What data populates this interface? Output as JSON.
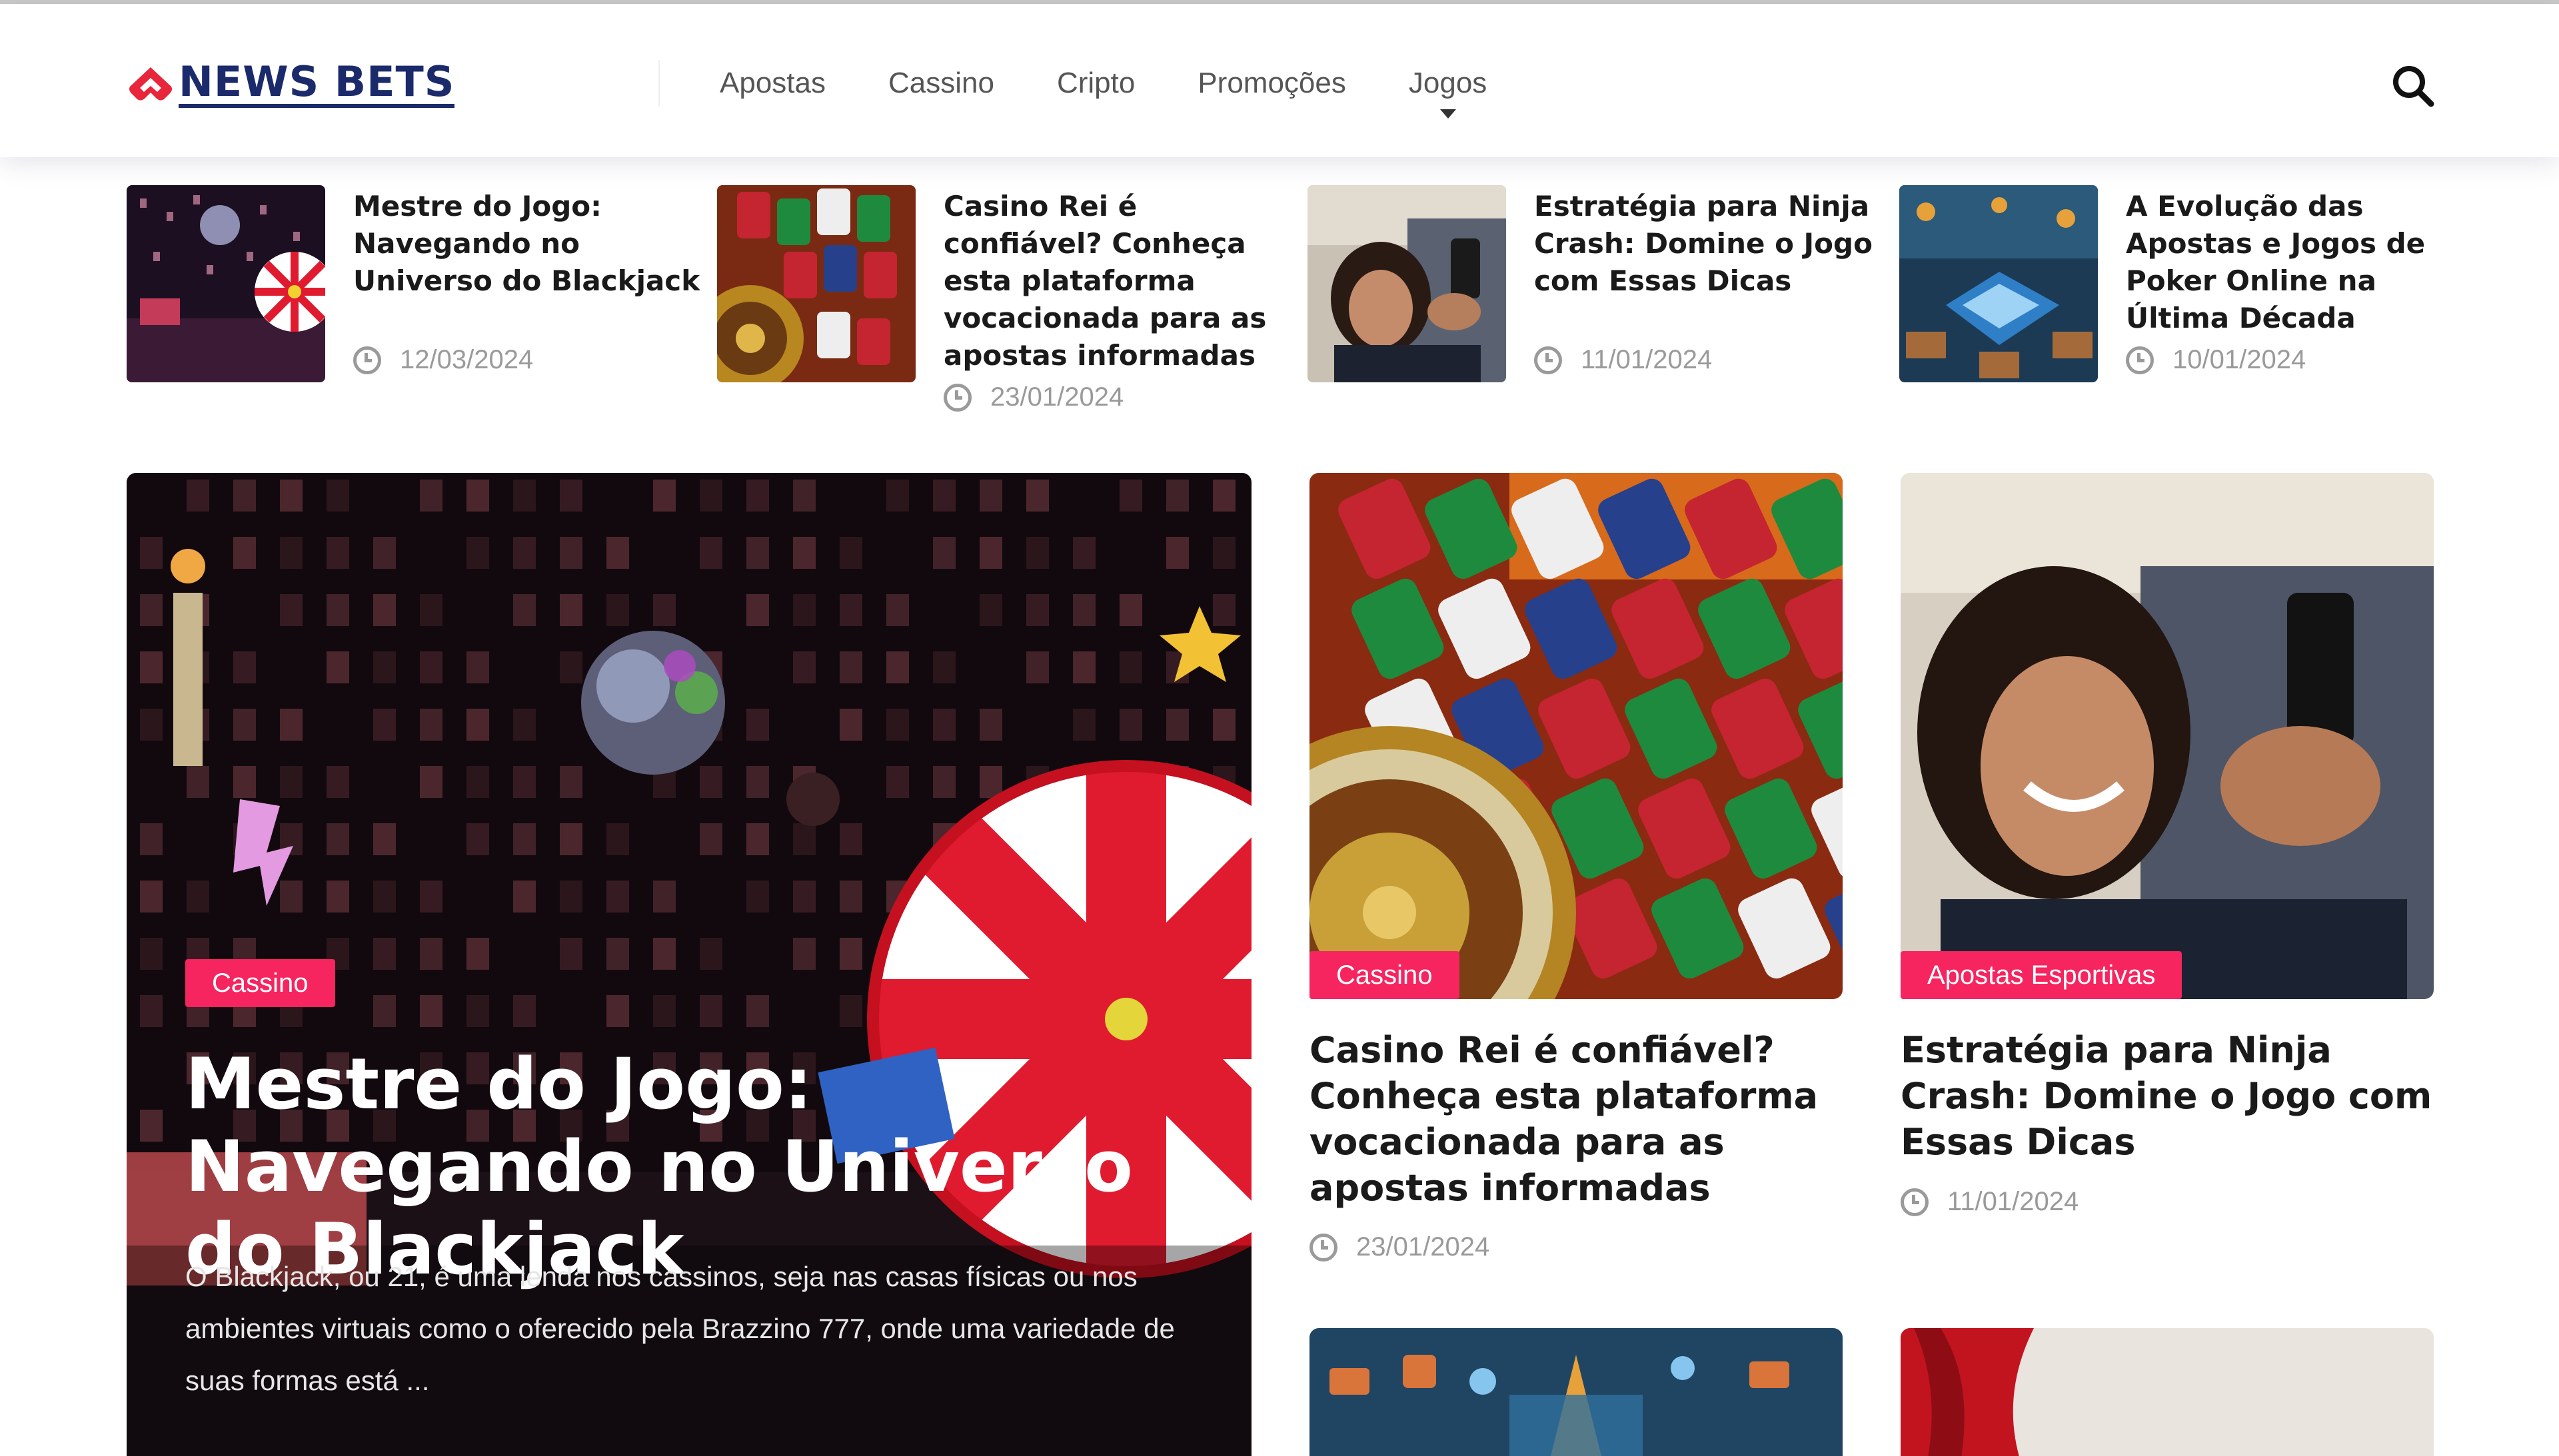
{
  "brand": {
    "name": "NEWS BETS",
    "primary_color": "#1b2a6b",
    "accent_color": "#f6245f"
  },
  "nav": {
    "items": [
      {
        "label": "Apostas"
      },
      {
        "label": "Cassino"
      },
      {
        "label": "Cripto"
      },
      {
        "label": "Promoções"
      },
      {
        "label": "Jogos",
        "has_dropdown": true
      }
    ],
    "search_icon": "search-icon"
  },
  "strip": [
    {
      "title": "Mestre do Jogo: Navegando no Universo do Blackjack",
      "date": "12/03/2024"
    },
    {
      "title": "Casino Rei é confiável? Conheça esta plataforma vocacionada para as apostas informadas",
      "date": "23/01/2024"
    },
    {
      "title": "Estratégia para Ninja Crash: Domine o Jogo com Essas Dicas",
      "date": "11/01/2024"
    },
    {
      "title": "A Evolução das Apostas e Jogos de Poker Online na Última Década",
      "date": "10/01/2024"
    }
  ],
  "hero": {
    "category": "Cassino",
    "title": "Mestre do Jogo: Navegando no Universo do Blackjack",
    "excerpt": "O Blackjack, ou 21, é uma lenda nos cassinos, seja nas casas físicas ou nos ambientes virtuais como o oferecido pela Brazzino 777, onde uma variedade de suas formas está ..."
  },
  "cards": [
    {
      "category": "Cassino",
      "title": "Casino Rei é confiável? Conheça esta plataforma vocacionada para as apostas informadas",
      "date": "23/01/2024"
    },
    {
      "category": "Apostas Esportivas",
      "title": "Estratégia para Ninja Crash: Domine o Jogo com Essas Dicas",
      "date": "11/01/2024"
    }
  ]
}
